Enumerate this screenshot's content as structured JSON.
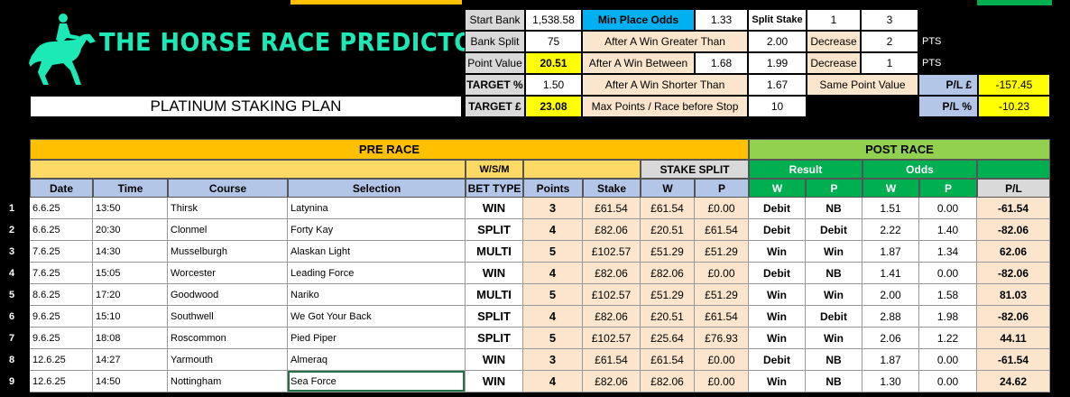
{
  "logo": {
    "title": "THE HORSE RACE PREDICTOR",
    "icon": "horse-and-jockey-icon",
    "color": "#1de9b6"
  },
  "plan_title": "PLATINUM STAKING PLAN",
  "settings": {
    "start_bank_label": "Start Bank",
    "start_bank": "1,538.58",
    "bank_split_label": "Bank Split",
    "bank_split": "75",
    "point_value_label": "Point Value",
    "point_value": "20.51",
    "target_pct_label": "TARGET %",
    "target_pct": "1.50",
    "target_gbp_label": "TARGET £",
    "target_gbp": "23.08",
    "min_place_odds_label": "Min Place Odds",
    "min_place_odds": "1.33",
    "after_win_greater_label": "After A Win Greater Than",
    "after_win_greater": "2.00",
    "after_win_between_label": "After A Win Between",
    "after_win_between_low": "1.68",
    "after_win_between_high": "1.99",
    "after_win_shorter_label": "After A Win Shorter Than",
    "after_win_shorter": "1.67",
    "max_points_label": "Max Points / Race before Stop",
    "max_points": "10",
    "split_stake_label": "Split Stake",
    "split_stake_a": "1",
    "split_stake_b": "3",
    "decrease_label_1": "Decrease",
    "decrease_1": "2",
    "pts_1": "PTS",
    "decrease_label_2": "Decrease",
    "decrease_2": "1",
    "pts_2": "PTS",
    "same_point_label": "Same Point Value",
    "pl_gbp_label": "P/L £",
    "pl_gbp": "-157.45",
    "pl_pct_label": "P/L %",
    "pl_pct": "-10.23"
  },
  "headers": {
    "pre_race": "PRE RACE",
    "post_race": "POST RACE",
    "wsm": "W/S/M",
    "stake_split": "STAKE SPLIT",
    "result": "Result",
    "odds": "Odds",
    "date": "Date",
    "time": "Time",
    "course": "Course",
    "selection": "Selection",
    "bet_type": "BET TYPE",
    "points": "Points",
    "stake": "Stake",
    "w": "W",
    "p": "P",
    "rw": "W",
    "rp": "P",
    "ow": "W",
    "op": "P",
    "pl": "P/L"
  },
  "rows": [
    {
      "n": "1",
      "date": "6.6.25",
      "time": "13:50",
      "course": "Thirsk",
      "selection": "Latynina",
      "bet": "WIN",
      "points": "3",
      "stake": "£61.54",
      "sw": "£61.54",
      "sp": "£0.00",
      "rw": "Debit",
      "rp": "NB",
      "ow": "1.51",
      "op": "0.00",
      "pl": "-61.54"
    },
    {
      "n": "2",
      "date": "6.6.25",
      "time": "20:30",
      "course": "Clonmel",
      "selection": "Forty Kay",
      "bet": "SPLIT",
      "points": "4",
      "stake": "£82.06",
      "sw": "£20.51",
      "sp": "£61.54",
      "rw": "Debit",
      "rp": "Debit",
      "ow": "2.22",
      "op": "1.40",
      "pl": "-82.06"
    },
    {
      "n": "3",
      "date": "7.6.25",
      "time": "14:30",
      "course": "Musselburgh",
      "selection": "Alaskan Light",
      "bet": "MULTI",
      "points": "5",
      "stake": "£102.57",
      "sw": "£51.29",
      "sp": "£51.29",
      "rw": "Win",
      "rp": "Win",
      "ow": "1.87",
      "op": "1.34",
      "pl": "62.06"
    },
    {
      "n": "4",
      "date": "7.6.25",
      "time": "15:05",
      "course": "Worcester",
      "selection": "Leading Force",
      "bet": "WIN",
      "points": "4",
      "stake": "£82.06",
      "sw": "£82.06",
      "sp": "£0.00",
      "rw": "Debit",
      "rp": "NB",
      "ow": "1.41",
      "op": "0.00",
      "pl": "-82.06"
    },
    {
      "n": "5",
      "date": "8.6.25",
      "time": "17:20",
      "course": "Goodwood",
      "selection": "Nariko",
      "bet": "MULTI",
      "points": "5",
      "stake": "£102.57",
      "sw": "£51.29",
      "sp": "£51.29",
      "rw": "Win",
      "rp": "Win",
      "ow": "2.00",
      "op": "1.58",
      "pl": "81.03"
    },
    {
      "n": "6",
      "date": "9.6.25",
      "time": "15:10",
      "course": "Southwell",
      "selection": "We Got Your Back",
      "bet": "SPLIT",
      "points": "4",
      "stake": "£82.06",
      "sw": "£20.51",
      "sp": "£61.54",
      "rw": "Win",
      "rp": "Debit",
      "ow": "2.88",
      "op": "1.98",
      "pl": "-82.06"
    },
    {
      "n": "7",
      "date": "9.6.25",
      "time": "18:08",
      "course": "Roscommon",
      "selection": "Pied Piper",
      "bet": "SPLIT",
      "points": "5",
      "stake": "£102.57",
      "sw": "£25.64",
      "sp": "£76.93",
      "rw": "Win",
      "rp": "Win",
      "ow": "2.06",
      "op": "1.22",
      "pl": "44.11"
    },
    {
      "n": "8",
      "date": "12.6.25",
      "time": "14:27",
      "course": "Yarmouth",
      "selection": "Almeraq",
      "bet": "WIN",
      "points": "3",
      "stake": "£61.54",
      "sw": "£61.54",
      "sp": "£0.00",
      "rw": "Debit",
      "rp": "NB",
      "ow": "1.87",
      "op": "0.00",
      "pl": "-61.54"
    },
    {
      "n": "9",
      "date": "12.6.25",
      "time": "14:50",
      "course": "Nottingham",
      "selection": "Sea Force",
      "bet": "WIN",
      "points": "4",
      "stake": "£82.06",
      "sw": "£82.06",
      "sp": "£0.00",
      "rw": "Win",
      "rp": "NB",
      "ow": "1.30",
      "op": "0.00",
      "pl": "24.62"
    }
  ],
  "colors": {
    "orange": "#ffc000",
    "yellow": "#ffff00",
    "green": "#92d050",
    "dark_green": "#00b050",
    "blue_header": "#b4c6e7",
    "peach": "#fbe5cc"
  }
}
